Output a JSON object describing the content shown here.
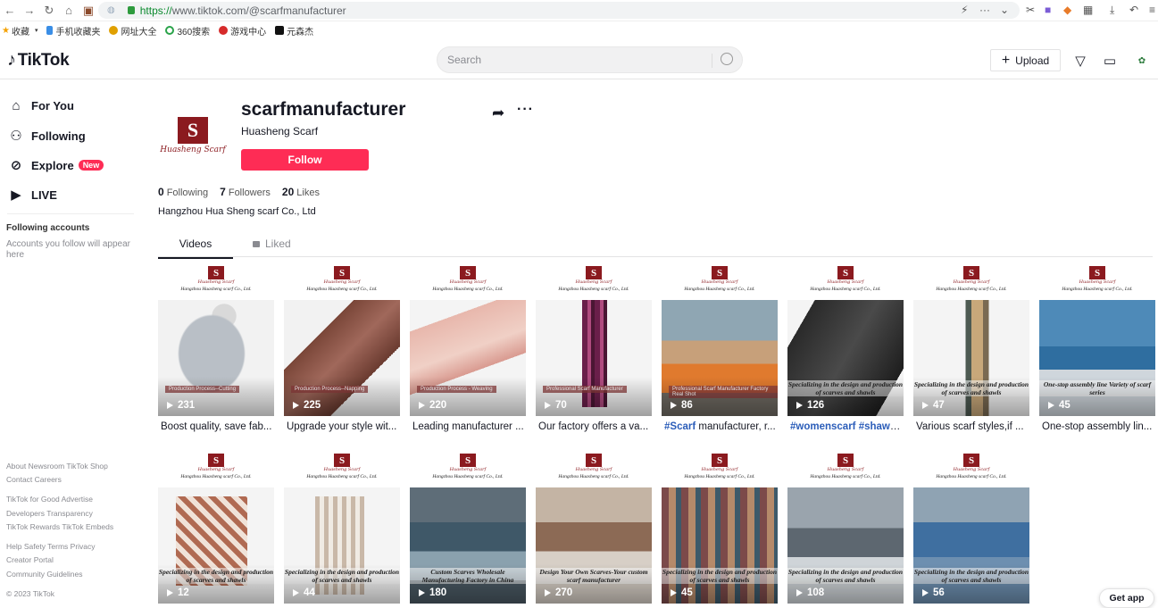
{
  "browser": {
    "url_proto": "https://",
    "url_rest": "www.tiktok.com/@scarfmanufacturer",
    "bookmarks": [
      "收藏",
      "手机收藏夹",
      "网址大全",
      "360搜索",
      "游戏中心",
      "元森杰"
    ]
  },
  "header": {
    "logo_text": "TikTok",
    "search_placeholder": "Search",
    "upload_label": "Upload",
    "brand_color": "#fe2c55"
  },
  "sidebar": {
    "items": [
      {
        "label": "For You",
        "icon": "home-icon"
      },
      {
        "label": "Following",
        "icon": "users-icon"
      },
      {
        "label": "Explore",
        "icon": "compass-icon",
        "badge": "New"
      },
      {
        "label": "LIVE",
        "icon": "live-icon"
      }
    ],
    "following_title": "Following accounts",
    "following_desc": "Accounts you follow will appear here",
    "footer": {
      "row1": "About  Newsroom  TikTok Shop",
      "row2": "Contact  Careers",
      "row3": "TikTok for Good  Advertise",
      "row4": "Developers  Transparency",
      "row5": "TikTok Rewards  TikTok Embeds",
      "row6": "Help  Safety  Terms  Privacy",
      "row7": "Creator Portal",
      "row8": "Community Guidelines",
      "copyright": "© 2023 TikTok"
    }
  },
  "profile": {
    "username": "scarfmanufacturer",
    "nickname": "Huasheng Scarf",
    "follow_label": "Follow",
    "avatar_mark": "S",
    "avatar_sig": "Huasheng Scarf",
    "following_count": "0",
    "following_label": "Following",
    "followers_count": "7",
    "followers_label": "Followers",
    "likes_count": "20",
    "likes_label": "Likes",
    "bio": "Hangzhou Hua Sheng scarf Co., Ltd"
  },
  "tabs": {
    "videos": "Videos",
    "liked": "Liked"
  },
  "thumb_brand": {
    "mark": "S",
    "sig": "Huasheng Scarf",
    "company": "Hangzhou Huasheng scarf Co., Ltd."
  },
  "videos": [
    {
      "views": "231",
      "desc": "Boost quality, save fab...",
      "tag": "Production Process--Cutting",
      "photo": "beanie"
    },
    {
      "views": "225",
      "desc": "Upgrade your style wit...",
      "tag": "Production Process--Napping",
      "photo": "poncho"
    },
    {
      "views": "220",
      "desc": "Leading manufacturer ...",
      "tag": "Production Process - Weaving",
      "photo": "scarf-pink"
    },
    {
      "views": "70",
      "desc": "Our factory offers a va...",
      "tag": "Professional Scarf Manufacturer",
      "photo": "scarf-plaid"
    },
    {
      "views": "86",
      "desc_hash": "#Scarf",
      "desc": " manufacturer, r...",
      "tag": "Professional Scarf Manufacturer Factory Real Shot",
      "photo": "factory-orange"
    },
    {
      "views": "126",
      "desc_hash": "#womenscarf #shawl",
      "desc": " ...",
      "caption": "Specializing in the design and production of scarves and shawls",
      "photo": "shawl-black"
    },
    {
      "views": "47",
      "desc": "Various scarf styles,if ...",
      "caption": "Specializing in the design and production of scarves and shawls",
      "photo": "mannequin"
    },
    {
      "views": "45",
      "desc": "One-stop assembly lin...",
      "caption": "One-stop assembly line Variety of scarf series",
      "photo": "sewing"
    },
    {
      "views": "12",
      "desc": "",
      "caption": "Specializing in the design and production of scarves and shawls",
      "photo": "scarf-brown"
    },
    {
      "views": "44",
      "desc": "",
      "caption": "Specializing in the design and production of scarves and shawls",
      "photo": "mannequin-plaid"
    },
    {
      "views": "180",
      "desc": "",
      "caption": "Custom Scarves Wholesale Manufacturing Factory in China",
      "photo": "loom"
    },
    {
      "views": "270",
      "desc": "",
      "caption": "Design Your Own Scarves-Your custom scarf manufacturer",
      "photo": "showroom"
    },
    {
      "views": "45",
      "desc": "",
      "caption": "Specializing in the design and production of scarves and shawls",
      "photo": "shop"
    },
    {
      "views": "108",
      "desc": "",
      "caption": "Specializing in the design and production of scarves and shawls",
      "photo": "workshop"
    },
    {
      "views": "56",
      "desc": "",
      "caption": "Specializing in the design and production of scarves and shawls",
      "photo": "warehouse"
    }
  ],
  "get_app": "Get app"
}
